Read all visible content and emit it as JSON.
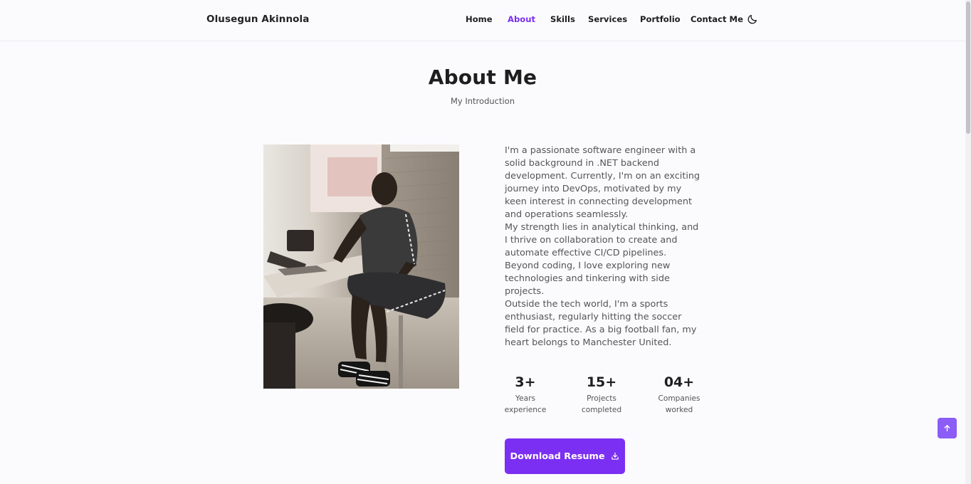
{
  "brand": {
    "name": "Olusegun Akinnola"
  },
  "nav": {
    "items": [
      {
        "label": "Home",
        "active": false
      },
      {
        "label": "About",
        "active": true
      },
      {
        "label": "Skills",
        "active": false
      },
      {
        "label": "Services",
        "active": false
      },
      {
        "label": "Portfolio",
        "active": false
      },
      {
        "label": "Contact Me",
        "active": false
      }
    ],
    "theme_toggle_icon": "moon-icon"
  },
  "section": {
    "title": "About Me",
    "subtitle": "My Introduction"
  },
  "about": {
    "paragraphs": [
      "I'm a passionate software engineer with a solid background in .NET backend development. Currently, I'm on an exciting journey into DevOps, motivated by my keen interest in connecting development and operations seamlessly.",
      "My strength lies in analytical thinking, and I thrive on collaboration to create and automate effective CI/CD pipelines.",
      "Beyond coding, I love exploring new technologies and tinkering with side projects.",
      "Outside the tech world, I'm a sports enthusiast, regularly hitting the soccer field for practice. As a big football fan, my heart belongs to Manchester United."
    ]
  },
  "stats": [
    {
      "value": "3+",
      "label_line1": "Years",
      "label_line2": "experience"
    },
    {
      "value": "15+",
      "label_line1": "Projects",
      "label_line2": "completed"
    },
    {
      "value": "04+",
      "label_line1": "Companies",
      "label_line2": "worked"
    }
  ],
  "resume_button": {
    "label": "Download Resume",
    "icon": "download-icon"
  },
  "scroll_top": {
    "icon": "arrow-up-icon"
  },
  "colors": {
    "accent": "#7b2ff2",
    "scroll_top_bg": "#8b5cf6",
    "background": "#fbfbfe"
  }
}
